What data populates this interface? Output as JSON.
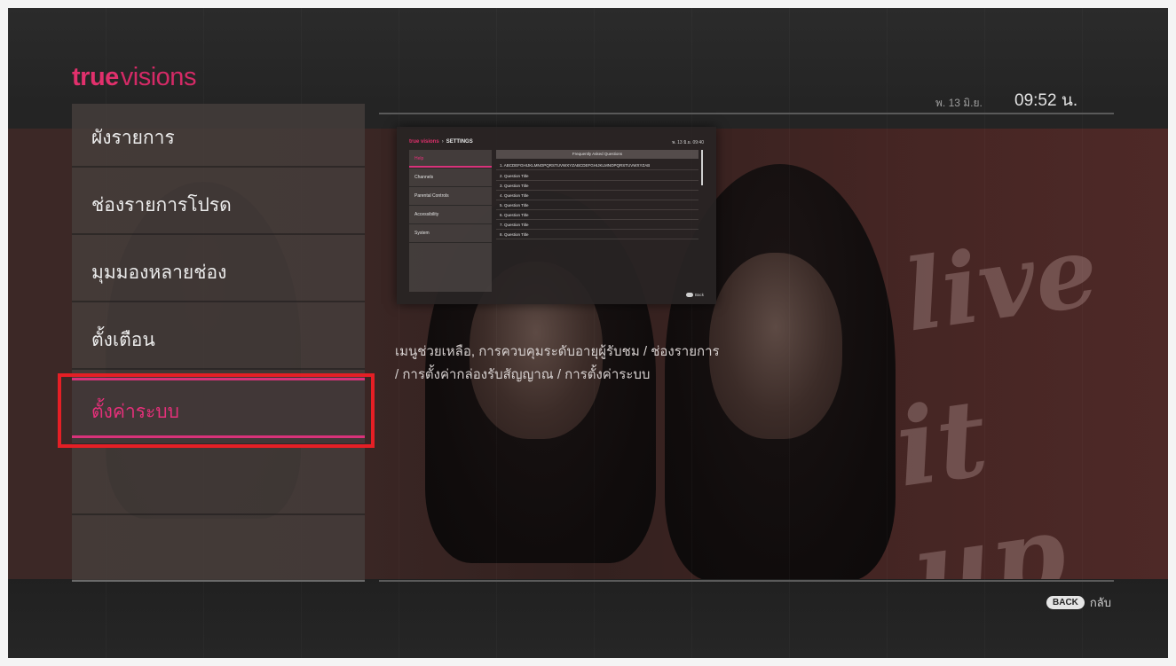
{
  "app": {
    "logo_true": "true",
    "logo_visions": "visions"
  },
  "header": {
    "date": "พ. 13 มิ.ย.",
    "time": "09:52 น."
  },
  "sidebar": {
    "items": [
      {
        "label": "ผังรายการ"
      },
      {
        "label": "ช่องรายการโปรด"
      },
      {
        "label": "มุมมองหลายช่อง"
      },
      {
        "label": "ตั้งเตือน"
      },
      {
        "label": "ตั้งค่าระบบ",
        "active": true
      }
    ]
  },
  "preview": {
    "logo": "true visions",
    "section": "SETTINGS",
    "time": "พ. 13 มิ.ย. 09:40",
    "nav": [
      "Help",
      "Channels",
      "Parental Controls",
      "Accessibility",
      "System"
    ],
    "faq_title": "Frequently Asked Questions",
    "questions": [
      "1. ABCDEFGHIJKLMNOPQRSTUVWXYZABCDEFGHIJKLMNOPQRSTUVWXYZAB",
      "2. Question Title",
      "3. Question Title",
      "4. Question Title",
      "5. Question Title",
      "6. Question Title",
      "7. Question Title",
      "8. Question Title"
    ],
    "back_label": "Back"
  },
  "description": {
    "line1": "เมนูช่วยเหลือ, การควบคุมระดับอายุผู้รับชม / ช่องรายการ",
    "line2": "/ การตั้งค่ากล่องรับสัญญาณ / การตั้งค่าระบบ"
  },
  "footer": {
    "back_key": "BACK",
    "back_label": "กลับ"
  },
  "colors": {
    "accent": "#d8327a",
    "highlight_box": "#e51f25"
  }
}
